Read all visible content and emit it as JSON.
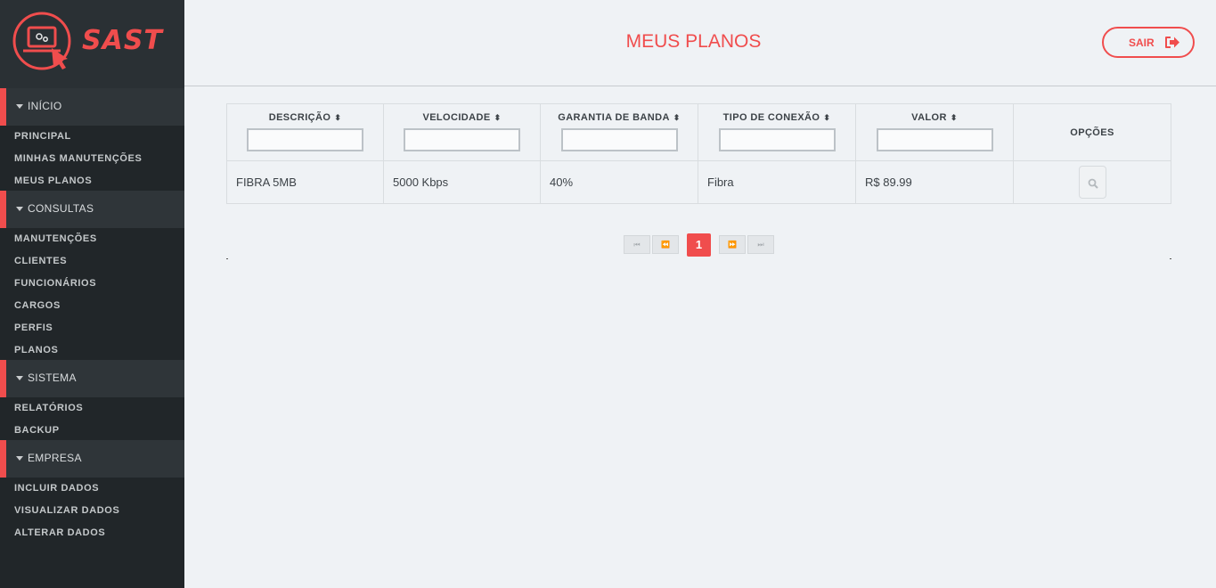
{
  "app": {
    "logo_text": "SAST"
  },
  "header": {
    "title": "MEUS PLANOS",
    "logout_label": "SAIR"
  },
  "sidebar": {
    "sections": [
      {
        "label": "INÍCIO",
        "items": [
          "PRINCIPAL",
          "MINHAS MANUTENÇÕES",
          "MEUS PLANOS"
        ]
      },
      {
        "label": "CONSULTAS",
        "items": [
          "MANUTENÇÕES",
          "CLIENTES",
          "FUNCIONÁRIOS",
          "CARGOS",
          "PERFIS",
          "PLANOS"
        ]
      },
      {
        "label": "SISTEMA",
        "items": [
          "RELATÓRIOS",
          "BACKUP"
        ]
      },
      {
        "label": "EMPRESA",
        "items": [
          "INCLUIR DADOS",
          "VISUALIZAR DADOS",
          "ALTERAR DADOS"
        ]
      }
    ]
  },
  "table": {
    "columns": [
      "DESCRIÇÃO",
      "VELOCIDADE",
      "GARANTIA DE BANDA",
      "TIPO DE CONEXÃO",
      "VALOR",
      "OPÇÕES"
    ],
    "rows": [
      [
        "FIBRA 5MB",
        "5000 Kbps",
        "40%",
        "Fibra",
        "R$ 89.99"
      ]
    ]
  },
  "pagination": {
    "first": "⏮",
    "prev": "⏪",
    "current": "1",
    "next": "⏩",
    "last": "⏭"
  },
  "colors": {
    "accent": "#f04d4d",
    "sidebar_bg": "#212629",
    "page_bg": "#eff2f5"
  },
  "icons": [
    "gear-laptop-logo-icon",
    "sort-icon",
    "sign-out-icon",
    "search-icon",
    "caret-down-icon"
  ]
}
